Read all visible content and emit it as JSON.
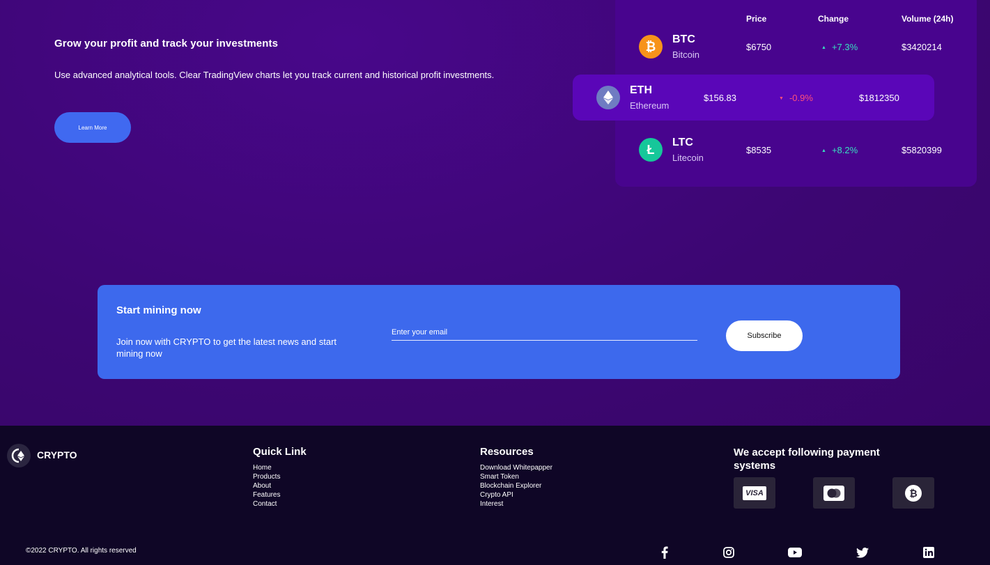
{
  "hero": {
    "title": "Grow your profit and track your investments",
    "description": "Use advanced analytical tools. Clear TradingView charts let you track current and historical profit investments.",
    "button_label": "Learn More"
  },
  "market": {
    "headers": {
      "price": "Price",
      "change": "Change",
      "volume": "Volume (24h)"
    },
    "coins": [
      {
        "symbol": "BTC",
        "name": "Bitcoin",
        "price": "$6750",
        "change": "+7.3%",
        "direction": "up",
        "volume": "$3420214",
        "icon": "bitcoin-icon",
        "color": "#f7931a",
        "glyph": "₿"
      },
      {
        "symbol": "ETH",
        "name": "Ethereum",
        "price": "$156.83",
        "change": "-0.9%",
        "direction": "down",
        "volume": "$1812350",
        "icon": "ethereum-icon",
        "color": "#6f7cc2",
        "glyph": "♦"
      },
      {
        "symbol": "LTC",
        "name": "Litecoin",
        "price": "$8535",
        "change": "+8.2%",
        "direction": "up",
        "volume": "$5820399",
        "icon": "litecoin-icon",
        "color": "#16c79a",
        "glyph": "Ł"
      }
    ]
  },
  "newsletter": {
    "title": "Start mining now",
    "description": "Join now with CRYPTO to get the latest news and start mining now",
    "email_placeholder": "Enter your email",
    "button_label": "Subscribe"
  },
  "footer": {
    "brand": "CRYPTO",
    "quick_link": {
      "title": "Quick Link",
      "items": [
        "Home",
        "Products",
        "About",
        "Features",
        "Contact"
      ]
    },
    "resources": {
      "title": "Resources",
      "items": [
        "Download Whitepapper",
        "Smart Token",
        "Blockchain Explorer",
        "Crypto API",
        "Interest"
      ]
    },
    "payment": {
      "title": "We accept following payment systems",
      "methods": [
        "visa-icon",
        "mastercard-icon",
        "bitcoin-icon"
      ],
      "visa_label": "VISA"
    },
    "copyright": "©2022 CRYPTO. All rights reserved",
    "social": [
      "facebook-icon",
      "instagram-icon",
      "youtube-icon",
      "twitter-icon",
      "linkedin-icon"
    ]
  },
  "colors": {
    "background": "#3f0678",
    "accent": "#4069f0",
    "up": "#38e0c0",
    "down": "#ff4f7b",
    "footer": "#0f0626"
  }
}
